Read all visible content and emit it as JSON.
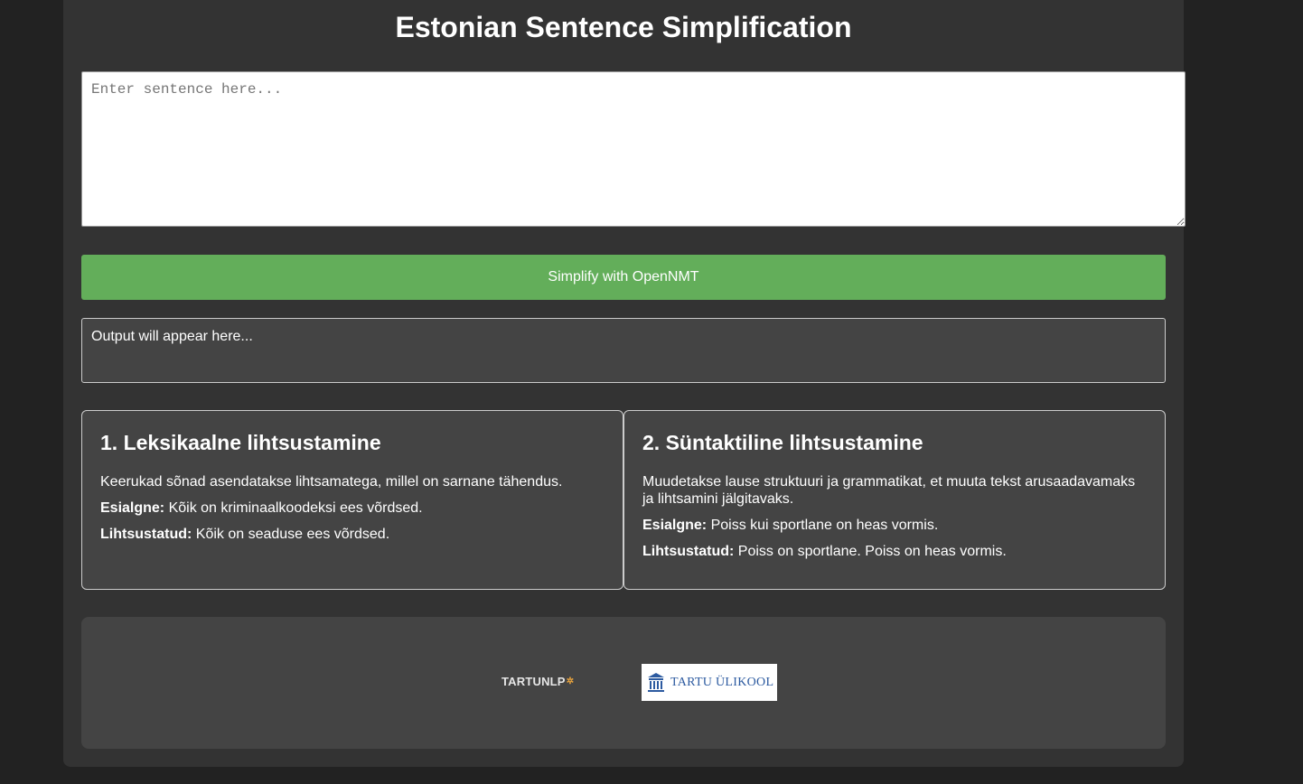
{
  "page": {
    "title": "Estonian Sentence Simplification"
  },
  "input": {
    "placeholder": "Enter sentence here...",
    "value": ""
  },
  "actions": {
    "simplify_label": "Simplify with OpenNMT"
  },
  "output": {
    "text": "Output will appear here..."
  },
  "cards": [
    {
      "heading": "1. Leksikaalne lihtsustamine",
      "description": "Keerukad sõnad asendatakse lihtsamatega, millel on sarnane tähendus.",
      "original_label": "Esialgne:",
      "original_text": " Kõik on kriminaalkoodeksi ees võrdsed.",
      "simplified_label": "Lihtsustatud:",
      "simplified_text": " Kõik on seaduse ees võrdsed."
    },
    {
      "heading": "2. Süntaktiline lihtsustamine",
      "description": "Muudetakse lause struktuuri ja grammatikat, et muuta tekst arusaadavamaks ja lihtsamini jälgitavaks.",
      "original_label": "Esialgne:",
      "original_text": " Poiss kui sportlane on heas vormis.",
      "simplified_label": "Lihtsustatud:",
      "simplified_text": " Poiss on sportlane. Poiss on heas vormis."
    }
  ],
  "footer": {
    "logo_nlp_text": "TARTUNLP",
    "logo_ut_text": "TARTU ÜLIKOOL"
  },
  "colors": {
    "page_background": "#222222",
    "container_background": "#333333",
    "panel_background": "#444444",
    "button_green": "#63ae5a",
    "ut_blue": "#2c5aa0"
  },
  "icons": {
    "ut_logo": "university-building-icon",
    "nlp_logo_mark": "sparkle-icon"
  }
}
